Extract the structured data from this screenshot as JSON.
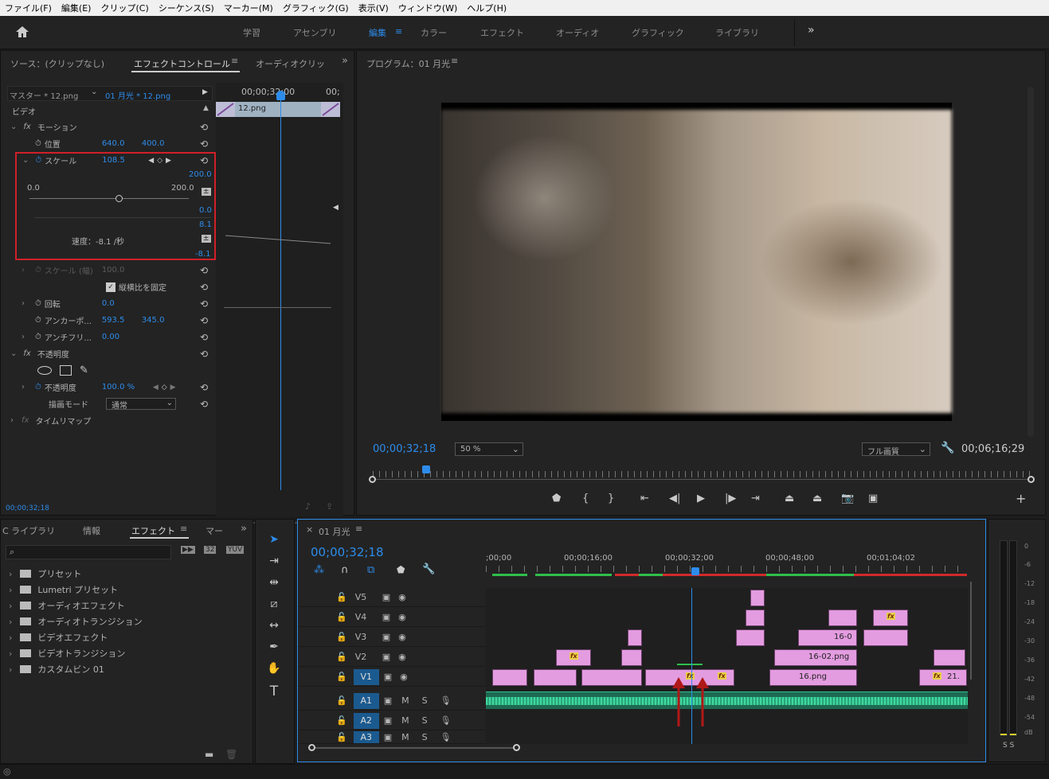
{
  "menu": [
    "ファイル(F)",
    "編集(E)",
    "クリップ(C)",
    "シーケンス(S)",
    "マーカー(M)",
    "グラフィック(G)",
    "表示(V)",
    "ウィンドウ(W)",
    "ヘルプ(H)"
  ],
  "workspaces": [
    "学習",
    "アセンブリ",
    "編集",
    "カラー",
    "エフェクト",
    "オーディオ",
    "グラフィック",
    "ライブラリ"
  ],
  "ws_more": "»",
  "effect_panel": {
    "tab_source": "ソース：(クリップなし)",
    "tab_effect": "エフェクトコントロール",
    "tab_audio": "オーディオクリップ",
    "master": "マスター * 12.png",
    "sequence": "01 月光 * 12.png",
    "timecode_head": "00;00;32;00",
    "timecode_tail": "00;",
    "clip_name": "12.png",
    "video_label": "ビデオ",
    "motion": "モーション",
    "position_label": "位置",
    "position_x": "640.0",
    "position_y": "400.0",
    "scale_label": "スケール",
    "scale_value": "108.5",
    "graph_top": "200.0",
    "slider_min": "0.0",
    "slider_max": "200.0",
    "graph_zero": "0.0",
    "vel_top": "8.1",
    "velocity": "速度：-8.1 /秒",
    "vel_bottom": "-8.1",
    "scale_width_label": "スケール (幅)",
    "scale_width_value": "100.0",
    "uniform_label": "縦横比を固定",
    "rotation_label": "回転",
    "rotation_value": "0.0",
    "anchor_label": "アンカーポ...",
    "anchor_x": "593.5",
    "anchor_y": "345.0",
    "anti_label": "アンチフリ...",
    "anti_value": "0.00",
    "opacity_section": "不透明度",
    "opacity_label": "不透明度",
    "opacity_value": "100.0 %",
    "blend_label": "描画モード",
    "blend_value": "通常",
    "time_remap": "タイムリマップ",
    "bottom_tc": "00;00;32;18"
  },
  "program": {
    "title": "プログラム：01 月光",
    "timecode": "00;00;32;18",
    "zoom": "50 %",
    "quality": "フル画質",
    "duration": "00;06;16;29"
  },
  "effects_panel": {
    "tab_lib": "C ライブラリ",
    "tab_info": "情報",
    "tab_effects": "エフェクト",
    "tab_marker": "マー",
    "items": [
      "プリセット",
      "Lumetri プリセット",
      "オーディオエフェクト",
      "オーディオトランジション",
      "ビデオエフェクト",
      "ビデオトランジション",
      "カスタムビン 01"
    ]
  },
  "timeline": {
    "tab": "01 月光",
    "timecode": "00;00;32;18",
    "ruler": [
      ";00;00",
      "00;00;16;00",
      "00;00;32;00",
      "00;00;48;00",
      "00;01;04;02"
    ],
    "video_tracks": [
      "V5",
      "V4",
      "V3",
      "V2",
      "V1"
    ],
    "audio_tracks": [
      "A1",
      "A2",
      "A3"
    ],
    "clip_16_0": "16-0",
    "clip_16_02": "16-02.png",
    "clip_16": "16.png",
    "clip_21": "21."
  },
  "meter": {
    "labels": [
      "0",
      "-6",
      "-12",
      "-18",
      "-24",
      "-30",
      "-36",
      "-42",
      "-48",
      "-54",
      "dB"
    ],
    "solo": "S S"
  },
  "colors": {
    "accent": "#2d8ceb",
    "clip": "#e39ce0",
    "audio": "#2fbf8f",
    "highlight_box": "#d0202a"
  }
}
